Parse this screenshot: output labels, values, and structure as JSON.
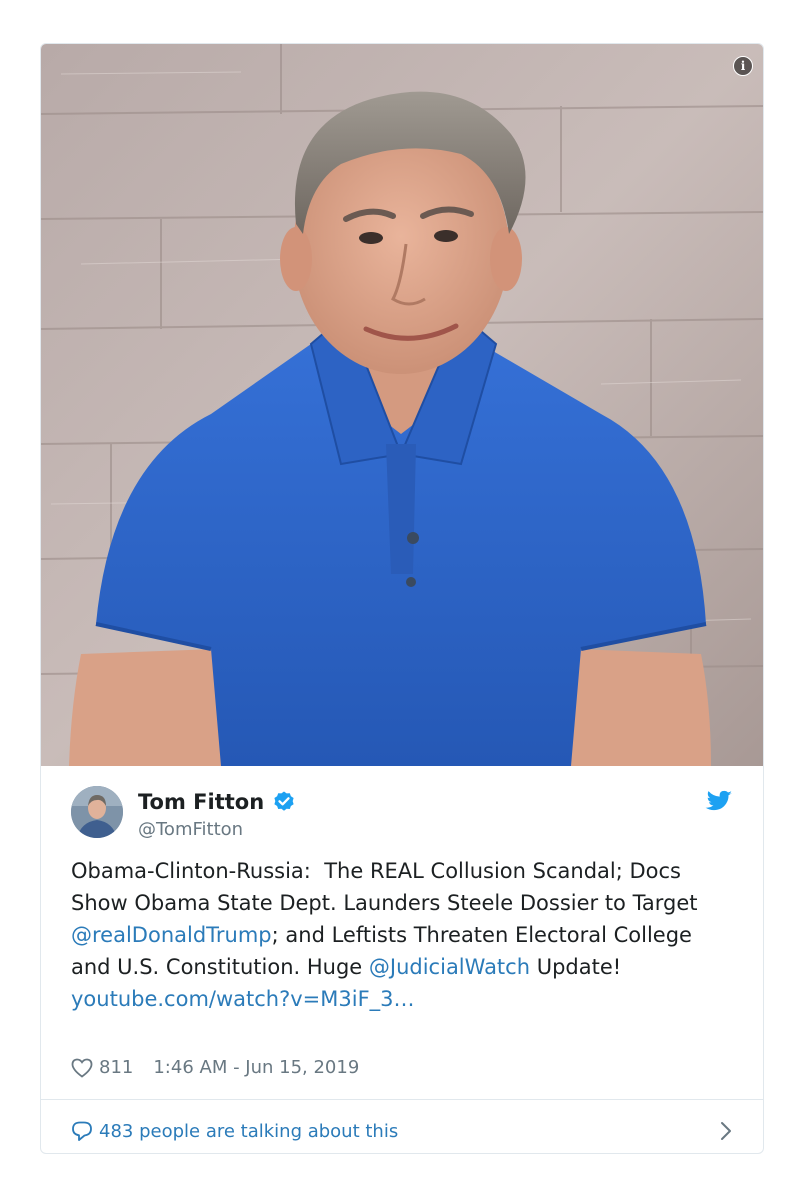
{
  "media": {
    "image_alt": "Photo of a man with gray hair wearing a blue polo shirt in front of a textured stone wall",
    "info_icon": "info-icon"
  },
  "tweet": {
    "author_name": "Tom Fitton",
    "author_handle": "@TomFitton",
    "verified_icon": "verified-badge-icon",
    "platform_icon": "twitter-bird-icon",
    "text_parts": {
      "p1": "Obama-Clinton-Russia:  The REAL Collusion Scandal; Docs Show Obama State Dept. Launders Steele Dossier to Target ",
      "mention1": "@realDonaldTrump",
      "p2": "; and Leftists Threaten Electoral College and U.S. Constitution. Huge ",
      "mention2": "@JudicialWatch",
      "p3": " Update! ",
      "link": "youtube.com/watch?v=M3iF_3…"
    },
    "likes": "811",
    "timestamp": "1:46 AM - Jun 15, 2019"
  },
  "footer": {
    "talking": "483 people are talking about this"
  },
  "colors": {
    "link": "#2b7bb9",
    "muted": "#697882",
    "twitter_blue": "#1da1f2",
    "shirt_blue": "#2f66c9"
  }
}
